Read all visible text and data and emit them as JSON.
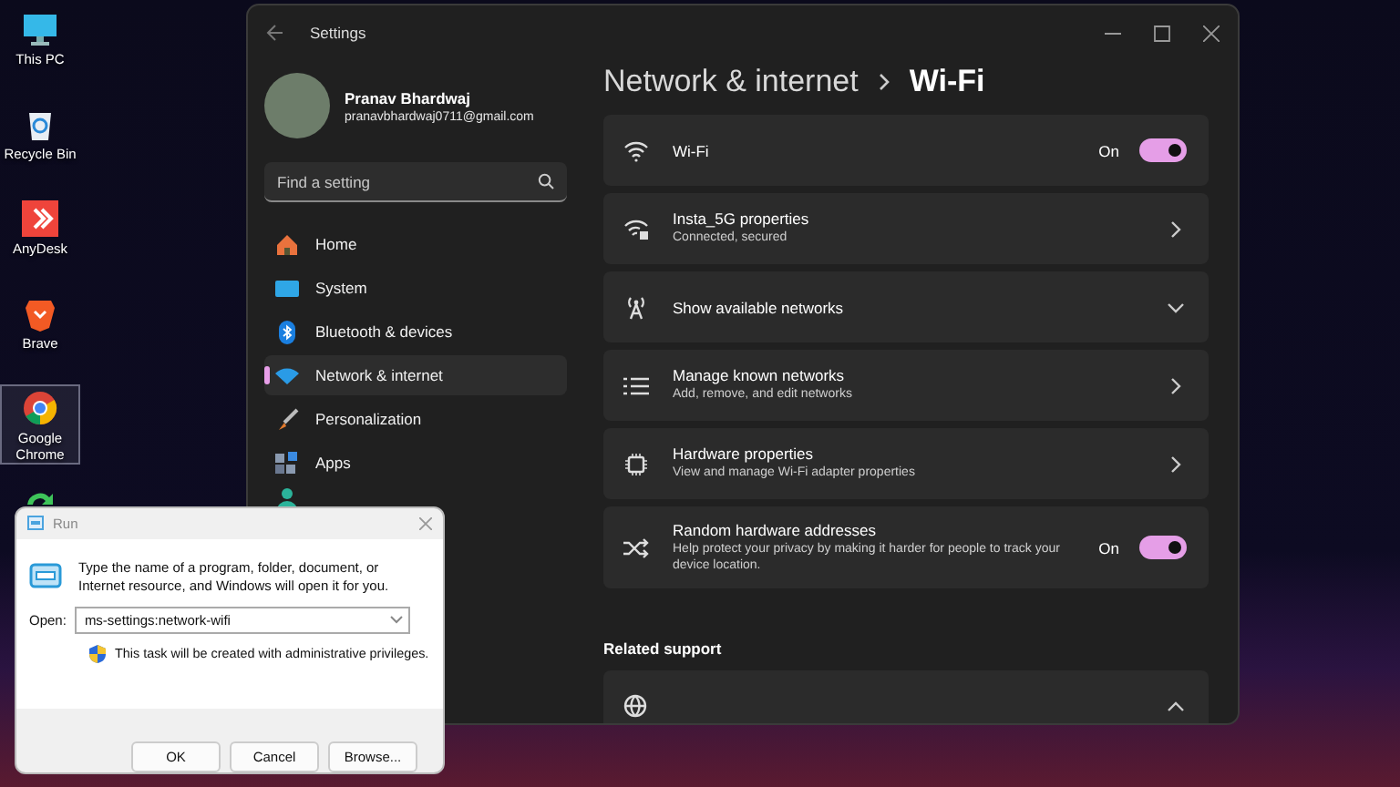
{
  "desktop": {
    "icons": [
      {
        "label": "This PC",
        "kind": "pc",
        "selected": false
      },
      {
        "label": "Recycle Bin",
        "kind": "bin",
        "selected": false
      },
      {
        "label": "AnyDesk",
        "kind": "anydesk",
        "selected": false
      },
      {
        "label": "Brave",
        "kind": "brave",
        "selected": false
      },
      {
        "label": "Google Chrome",
        "kind": "chrome",
        "selected": true
      },
      {
        "kind": "sync",
        "selected": false
      }
    ]
  },
  "settings": {
    "title": "Settings",
    "user": {
      "name": "Pranav Bhardwaj",
      "email": "pranavbhardwaj0711@gmail.com"
    },
    "search": {
      "placeholder": "Find a setting"
    },
    "nav": [
      {
        "label": "Home",
        "kind": "home",
        "selected": false
      },
      {
        "label": "System",
        "kind": "system",
        "selected": false
      },
      {
        "label": "Bluetooth & devices",
        "kind": "bluetooth",
        "selected": false
      },
      {
        "label": "Network & internet",
        "kind": "network",
        "selected": true
      },
      {
        "label": "Personalization",
        "kind": "brush",
        "selected": false
      },
      {
        "label": "Apps",
        "kind": "apps",
        "selected": false
      },
      {
        "kind": "account",
        "selected": false
      }
    ],
    "breadcrumb": {
      "parent": "Network & internet",
      "current": "Wi-Fi"
    },
    "cards": [
      {
        "kind": "toggle",
        "title": "Wi-Fi",
        "toggle_label": "On",
        "on": true
      },
      {
        "kind": "link",
        "title": "Insta_5G properties",
        "subtitle": "Connected, secured"
      },
      {
        "kind": "expand",
        "title": "Show available networks",
        "expanded": false
      },
      {
        "kind": "link",
        "title": "Manage known networks",
        "subtitle": "Add, remove, and edit networks"
      },
      {
        "kind": "link",
        "title": "Hardware properties",
        "subtitle": "View and manage Wi-Fi adapter properties"
      },
      {
        "kind": "toggle",
        "title": "Random hardware addresses",
        "subtitle": "Help protect your privacy by making it harder for people to track your device location.",
        "toggle_label": "On",
        "on": true
      }
    ],
    "related": {
      "heading": "Related support",
      "cards": [
        {
          "kind": "expand",
          "expanded": true
        }
      ]
    }
  },
  "run": {
    "title": "Run",
    "description": "Type the name of a program, folder, document, or Internet resource, and Windows will open it for you.",
    "open_label": "Open:",
    "value": "ms-settings:network-wifi",
    "admin_note": "This task will be created with administrative privileges.",
    "buttons": [
      "OK",
      "Cancel",
      "Browse..."
    ]
  }
}
